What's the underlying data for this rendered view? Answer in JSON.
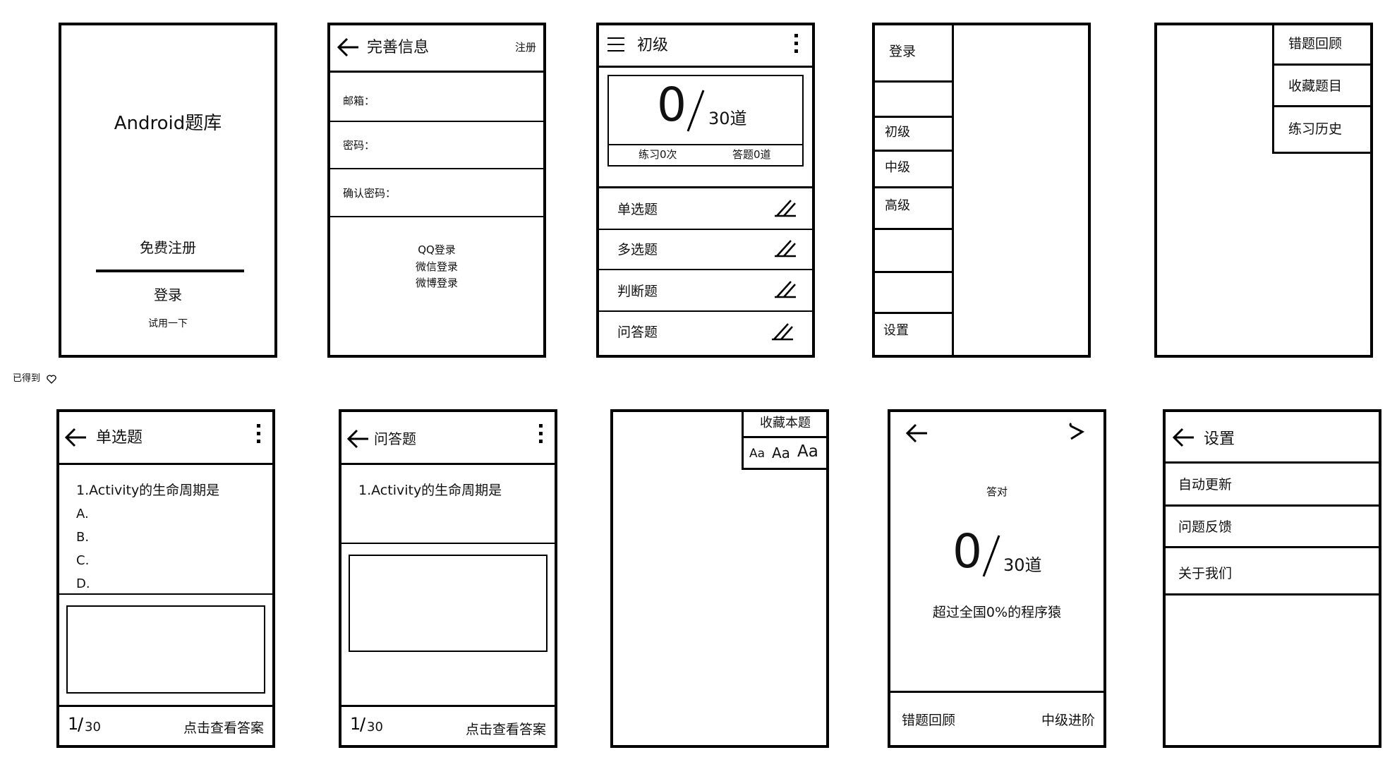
{
  "screen1": {
    "title": "Android题库",
    "register": "免费注册",
    "login": "登录",
    "trial": "试用一下"
  },
  "screen2": {
    "title": "完善信息",
    "action": "注册",
    "email": "邮箱：",
    "password": "密码：",
    "confirm": "确认密码：",
    "qq": "QQ登录",
    "wechat": "微信登录",
    "weibo": "微博登录"
  },
  "screen3": {
    "title": "初级",
    "count": "0",
    "total": "30道",
    "practiced": "练习0次",
    "answered": "答题0道",
    "items": [
      "单选题",
      "多选题",
      "判断题",
      "问答题"
    ]
  },
  "screen4": {
    "login": "登录",
    "levels": [
      "初级",
      "中级",
      "高级"
    ],
    "settings": "设置"
  },
  "screen5": {
    "menu": [
      "错题回顾",
      "收藏题目",
      "练习历史"
    ]
  },
  "side_note": "已得到",
  "screen6": {
    "title": "单选题",
    "question": "1.Activity的生命周期是",
    "options": [
      "A.",
      "B.",
      "C.",
      "D."
    ],
    "page_current": "1",
    "page_total": "30",
    "show_answer": "点击查看答案"
  },
  "screen7": {
    "title": "问答题",
    "question": "1.Activity的生命周期是",
    "page_current": "1",
    "page_total": "30",
    "show_answer": "点击查看答案"
  },
  "screen8": {
    "favorite": "收藏本题",
    "font_sizes": [
      "Aa",
      "Aa",
      "Aa"
    ]
  },
  "screen9": {
    "label": "答对",
    "count": "0",
    "total": "30道",
    "summary": "超过全国0%的程序猿",
    "review": "错题回顾",
    "advance": "中级进阶"
  },
  "screen10": {
    "title": "设置",
    "items": [
      "自动更新",
      "问题反馈",
      "关于我们"
    ]
  }
}
